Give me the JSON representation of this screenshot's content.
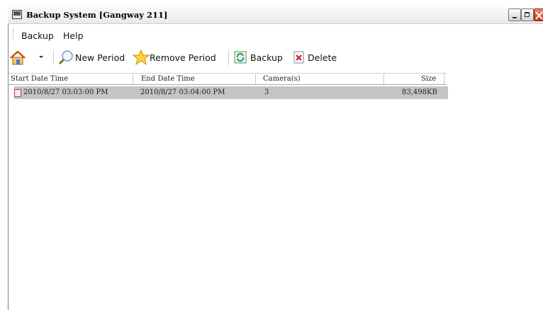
{
  "window": {
    "title": "Backup System [Gangway 211]"
  },
  "menu": [
    "Backup",
    "Help"
  ],
  "toolbar": {
    "new_period": "New Period",
    "remove_period": "Remove Period",
    "backup": "Backup",
    "delete": "Delete"
  },
  "table": {
    "columns": [
      "Start Date Time",
      "End Date Time",
      "Camera(s)",
      "Size"
    ],
    "rows": [
      {
        "start": "2010/8/27 03:03:00 PM",
        "end": "2010/8/27 03:04:00 PM",
        "cameras": "3",
        "size": "83,498KB"
      }
    ]
  },
  "icons": [
    "app-icon",
    "home-icon",
    "dropdown-arrow-icon",
    "magnifier-icon",
    "star-icon",
    "refresh-icon",
    "delete-icon",
    "record-icon"
  ],
  "colors": {
    "selected_row": "#c4c4c4",
    "close_button": "#d9462c"
  }
}
